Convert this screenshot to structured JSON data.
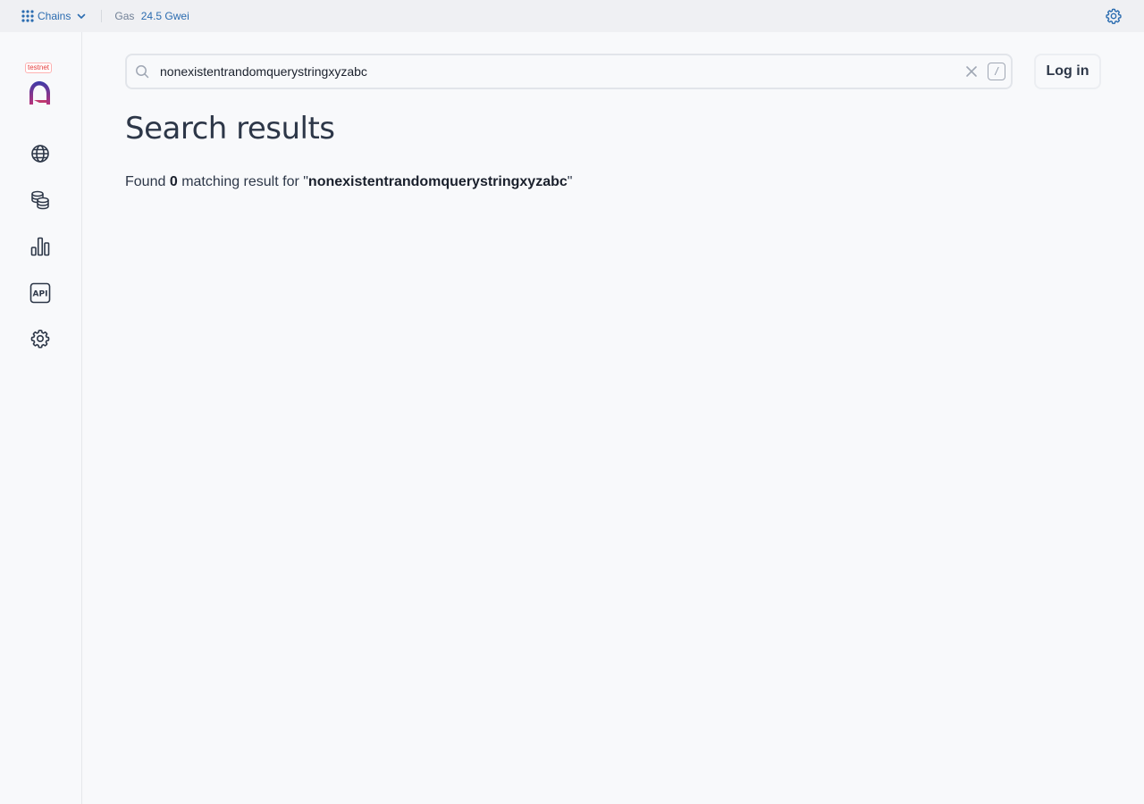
{
  "topbar": {
    "chains_label": "Chains",
    "gas_label": "Gas",
    "gas_value": "24.5 Gwei",
    "icons": [
      "grid-icon",
      "chevron-down-icon",
      "gear-icon"
    ]
  },
  "sidebar": {
    "badge": "testnet",
    "items": [
      {
        "name": "globe-icon"
      },
      {
        "name": "coins-icon"
      },
      {
        "name": "bar-chart-icon"
      },
      {
        "name": "api-icon",
        "text": "API"
      },
      {
        "name": "gear-icon"
      }
    ]
  },
  "search": {
    "value": "nonexistentrandomquerystringxyzabc",
    "shortcut": "/"
  },
  "header": {
    "login_label": "Log in"
  },
  "main": {
    "title": "Search results",
    "found_prefix": "Found",
    "count": "0",
    "found_middle": "matching result for \"",
    "query": "nonexistentrandomquerystringxyzabc",
    "found_suffix": "\""
  },
  "colors": {
    "accent": "#2b6cb0",
    "badge": "#e53e3e",
    "background": "#f8f9fb",
    "topbar": "#eff0f3"
  }
}
